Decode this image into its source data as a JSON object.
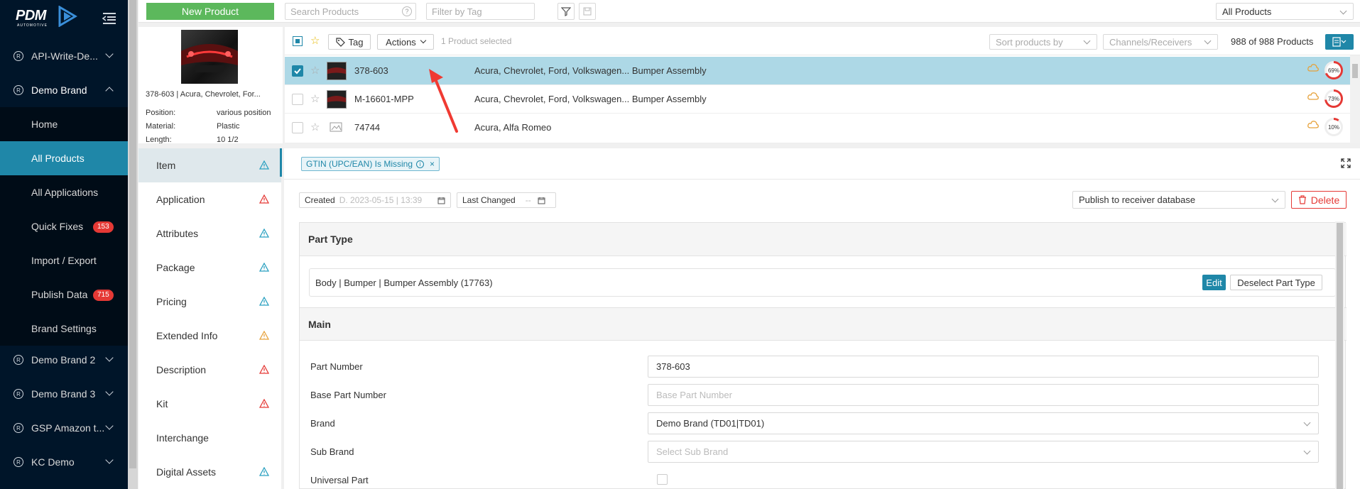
{
  "sidebar": {
    "logo_text": "PDM",
    "logo_sub": "AUTOMOTIVE",
    "brands_top": [
      {
        "label": "API-Write-De..."
      }
    ],
    "active_brand": {
      "label": "Demo Brand"
    },
    "sub_items": [
      {
        "label": "Home"
      },
      {
        "label": "All Products"
      },
      {
        "label": "All Applications"
      },
      {
        "label": "Quick Fixes",
        "badge": "153"
      },
      {
        "label": "Import / Export"
      },
      {
        "label": "Publish Data",
        "badge": "715"
      },
      {
        "label": "Brand Settings"
      }
    ],
    "brands_bottom": [
      {
        "label": "Demo Brand 2"
      },
      {
        "label": "Demo Brand 3"
      },
      {
        "label": "GSP Amazon t..."
      },
      {
        "label": "KC Demo"
      }
    ],
    "registered_mark": "R"
  },
  "topbar": {
    "new_product_label": "New Product",
    "search_placeholder": "Search Products",
    "filter_tag_placeholder": "Filter by Tag",
    "scope_select": "All Products"
  },
  "preview": {
    "title": "378-603 | Acura, Chevrolet, For...",
    "attributes": [
      {
        "key": "Position:",
        "value": "various position"
      },
      {
        "key": "Material:",
        "value": "Plastic"
      },
      {
        "key": "Length:",
        "value": "10 1/2"
      }
    ]
  },
  "list_toolbar": {
    "tag_label": "Tag",
    "actions_label": "Actions",
    "selected_text": "1 Product selected",
    "sort_placeholder": "Sort products by",
    "channels_placeholder": "Channels/Receivers",
    "count_text": "988 of 988 Products"
  },
  "products": [
    {
      "part_number": "378-603",
      "applications": "Acura, Chevrolet, Ford, Volkswagen... Bumper Assembly",
      "score": "69%",
      "score_value": 69,
      "selected": true
    },
    {
      "part_number": "M-16601-MPP",
      "applications": "Acura, Chevrolet, Ford, Volkswagen... Bumper Assembly",
      "score": "73%",
      "score_value": 73,
      "selected": false
    },
    {
      "part_number": "74744",
      "applications": "Acura, Alfa Romeo",
      "score": "10%",
      "score_value": 10,
      "selected": false
    }
  ],
  "tabs": [
    {
      "label": "Item",
      "warn": "blue"
    },
    {
      "label": "Application",
      "warn": "red"
    },
    {
      "label": "Attributes",
      "warn": "blue"
    },
    {
      "label": "Package",
      "warn": "blue"
    },
    {
      "label": "Pricing",
      "warn": "blue"
    },
    {
      "label": "Extended Info",
      "warn": "orange"
    },
    {
      "label": "Description",
      "warn": "red"
    },
    {
      "label": "Kit",
      "warn": "red"
    },
    {
      "label": "Interchange",
      "warn": ""
    },
    {
      "label": "Digital Assets",
      "warn": "blue"
    }
  ],
  "main": {
    "issue_tag": "GTIN (UPC/EAN) Is Missing",
    "created_label": "Created",
    "created_value": "D. 2023-05-15 | 13:39",
    "last_changed_label": "Last Changed",
    "last_changed_value": "--",
    "publish_select": "Publish to receiver database",
    "delete_label": "Delete",
    "part_type_header": "Part Type",
    "part_type_value": "Body | Bumper | Bumper Assembly (17763)",
    "edit_label": "Edit",
    "deselect_label": "Deselect Part Type",
    "main_header": "Main",
    "fields": [
      {
        "label": "Part Number",
        "value": "378-603",
        "placeholder": ""
      },
      {
        "label": "Base Part Number",
        "value": "",
        "placeholder": "Base Part Number"
      },
      {
        "label": "Brand",
        "value": "Demo Brand (TD01|TD01)",
        "placeholder": ""
      },
      {
        "label": "Sub Brand",
        "value": "",
        "placeholder": "Select Sub Brand"
      },
      {
        "label": "Universal Part",
        "value": "",
        "placeholder": ""
      }
    ]
  },
  "colors": {
    "accent": "#1f87a8",
    "sidebar": "#001529",
    "green": "#5cb85c",
    "danger": "#e53935",
    "selected_row": "#add8e6"
  }
}
